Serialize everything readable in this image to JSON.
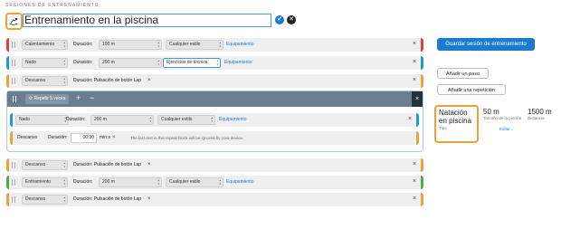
{
  "breadcrumb": "Sesiones de entrenamiento",
  "workout": {
    "title": "Entrenamiento en la piscina"
  },
  "labels": {
    "duration": "Duración:",
    "equipment": "Equipamiento",
    "lap_button": "Duración: Pulsación de botón Lap",
    "rest": "Descanso",
    "duration_short": "Duración:",
    "unit": "min:s",
    "remove": "×"
  },
  "steps": [
    {
      "type": "Calentamiento",
      "duration": "100 m",
      "stroke": "Cualquier estilo",
      "stripe": "#e0403a"
    },
    {
      "type": "Nado",
      "duration": "200 m",
      "stroke": "Ejercicios de técnica",
      "stripe": "#1a9ad6"
    },
    {
      "type": "Descanso",
      "stripe": "#e8a33a"
    }
  ],
  "repeat": {
    "button": "Repetir 5 veces",
    "plus": "+",
    "minus": "−",
    "close": "×",
    "swim": {
      "type": "Nado",
      "duration": "200 m",
      "stroke": "Cualquier estilo"
    },
    "rest": {
      "time": "00:30",
      "note": "The last rest in this repeat block will be ignored by your device."
    }
  },
  "after_steps": [
    {
      "type": "Descanso"
    },
    {
      "type": "Enfriamiento",
      "duration": "200 m",
      "stroke": "Cualquier estilo"
    },
    {
      "type": "Descanso"
    }
  ],
  "colors": {
    "warmup": "#e0403a",
    "swim": "#1a9ad6",
    "rest": "#e8a33a",
    "cooldown": "#4caf3f",
    "accent": "#1a7bd1"
  },
  "sidebar": {
    "save": "Guardar sesión de entrenamiento",
    "add_step": "Añadir un paso",
    "add_repeat": "Añadir una repetición",
    "sport": {
      "value": "Natación en piscina",
      "label": "Tipo"
    },
    "pool": {
      "value": "50 m",
      "label": "Tamaño de la piscina",
      "edit": "Editar..."
    },
    "distance": {
      "value": "1500 m",
      "label": "Distancia"
    }
  }
}
